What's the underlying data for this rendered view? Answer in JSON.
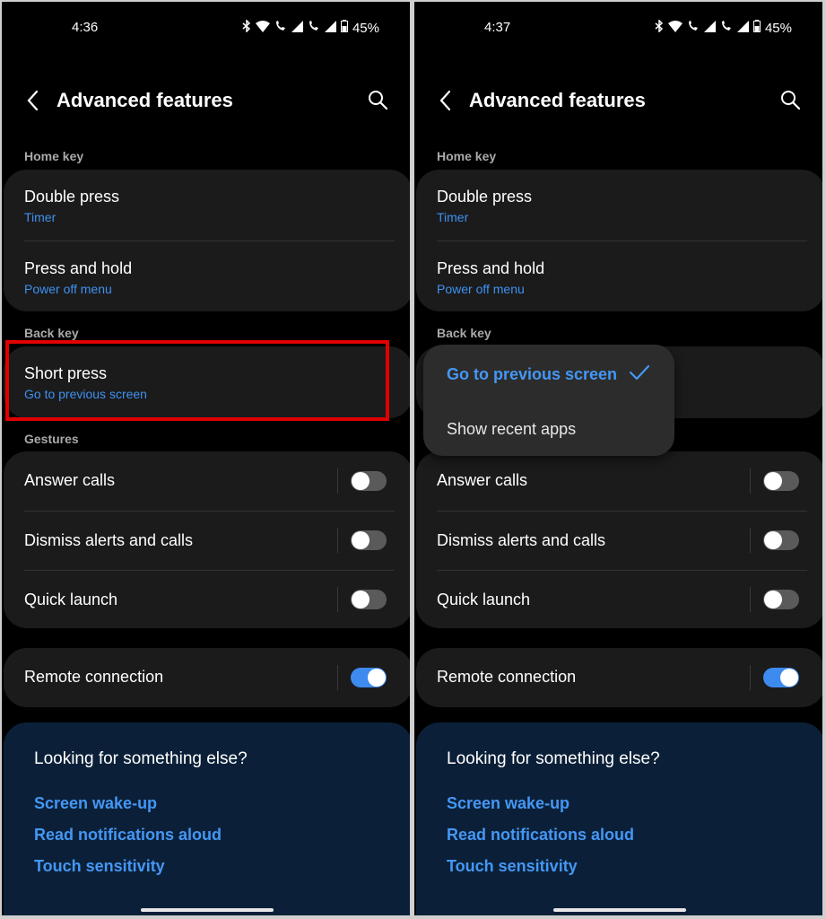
{
  "left": {
    "status": {
      "time": "4:36",
      "battery": "45%"
    },
    "title": "Advanced features",
    "sections": {
      "home_key": "Home key",
      "back_key": "Back key",
      "gestures": "Gestures"
    },
    "double_press": {
      "title": "Double press",
      "value": "Timer"
    },
    "press_hold": {
      "title": "Press and hold",
      "value": "Power off menu"
    },
    "short_press": {
      "title": "Short press",
      "value": "Go to previous screen"
    },
    "toggles": {
      "answer_calls": {
        "label": "Answer calls",
        "on": false
      },
      "dismiss_alerts": {
        "label": "Dismiss alerts and calls",
        "on": false
      },
      "quick_launch": {
        "label": "Quick launch",
        "on": false
      },
      "remote_connection": {
        "label": "Remote connection",
        "on": true
      }
    },
    "help": {
      "title": "Looking for something else?",
      "links": [
        "Screen wake-up",
        "Read notifications aloud",
        "Touch sensitivity"
      ]
    }
  },
  "right": {
    "status": {
      "time": "4:37",
      "battery": "45%"
    },
    "title": "Advanced features",
    "sections": {
      "home_key": "Home key",
      "back_key": "Back key"
    },
    "double_press": {
      "title": "Double press",
      "value": "Timer"
    },
    "press_hold": {
      "title": "Press and hold",
      "value": "Power off menu"
    },
    "popup": {
      "selected": "Go to previous screen",
      "option": "Show recent apps"
    },
    "toggles": {
      "answer_calls": {
        "label": "Answer calls",
        "on": false
      },
      "dismiss_alerts": {
        "label": "Dismiss alerts and calls",
        "on": false
      },
      "quick_launch": {
        "label": "Quick launch",
        "on": false
      },
      "remote_connection": {
        "label": "Remote connection",
        "on": true
      }
    },
    "help": {
      "title": "Looking for something else?",
      "links": [
        "Screen wake-up",
        "Read notifications aloud",
        "Touch sensitivity"
      ]
    }
  },
  "colors": {
    "accent": "#3e91f2",
    "highlight": "#e00000",
    "help_background": "#0b2038",
    "card_background": "#1b1b1b"
  }
}
